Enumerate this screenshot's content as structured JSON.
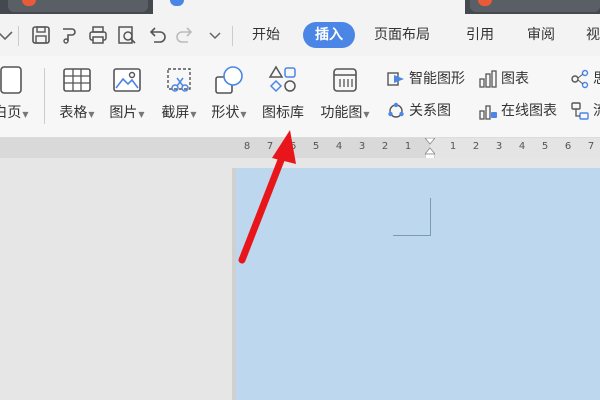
{
  "menubar": {
    "items": [
      "开始",
      "插入",
      "页面布局",
      "引用",
      "审阅",
      "视"
    ],
    "active": "插入"
  },
  "ribbon": {
    "tools": [
      {
        "name": "blank-page",
        "label": "白页",
        "icon": "page-icon"
      },
      {
        "name": "table",
        "label": "表格",
        "icon": "table-icon"
      },
      {
        "name": "picture",
        "label": "图片",
        "icon": "picture-icon"
      },
      {
        "name": "screenshot",
        "label": "截屏",
        "icon": "screenshot-icon"
      },
      {
        "name": "shape",
        "label": "形状",
        "icon": "shape-icon"
      },
      {
        "name": "icon-library",
        "label": "图标库",
        "icon": "icon-library-icon"
      },
      {
        "name": "function-chart",
        "label": "功能图",
        "icon": "function-chart-icon"
      }
    ],
    "small_tools": [
      {
        "label": "智能图形",
        "icon": "smart-graphic-icon"
      },
      {
        "label": "关系图",
        "icon": "relation-chart-icon"
      },
      {
        "label": "图表",
        "icon": "chart-icon"
      },
      {
        "label": "在线图表",
        "icon": "online-chart-icon"
      },
      {
        "label": "思",
        "icon": "mindmap-icon"
      },
      {
        "label": "流",
        "icon": "flowchart-icon"
      }
    ]
  },
  "ruler": {
    "left_numbers": [
      "8",
      "7",
      "6",
      "5",
      "4",
      "3",
      "2",
      "1"
    ],
    "right_numbers": [
      "1",
      "2",
      "3",
      "4",
      "5",
      "6",
      "7"
    ]
  },
  "colors": {
    "accent": "#4b86e6",
    "arrow": "#e8161b",
    "page": "#bcd7ee"
  }
}
